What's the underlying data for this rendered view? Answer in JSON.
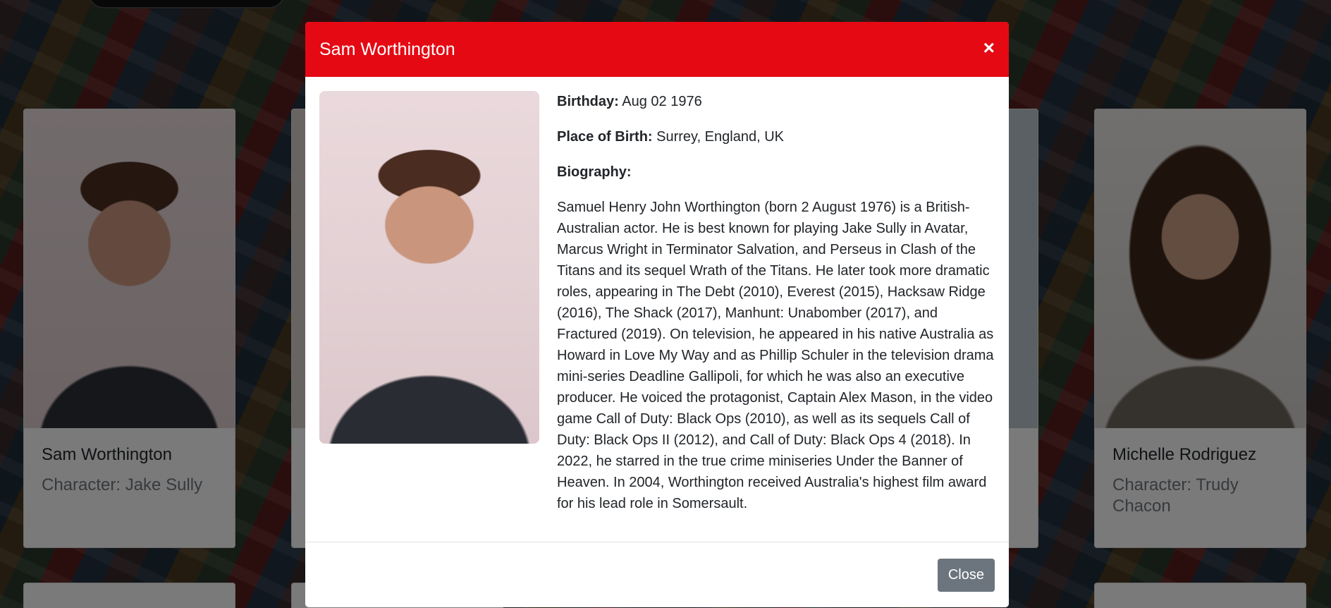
{
  "modal": {
    "title": "Sam Worthington",
    "close_icon": "×",
    "birthday_label": "Birthday:",
    "birthday_value": "Aug 02 1976",
    "place_label": "Place of Birth:",
    "place_value": "Surrey, England, UK",
    "bio_label": "Biography:",
    "bio_text": "Samuel Henry John Worthington (born 2 August 1976) is a British-Australian actor. He is best known for playing Jake Sully in Avatar, Marcus Wright in Terminator Salvation, and Perseus in Clash of the Titans and its sequel Wrath of the Titans. He later took more dramatic roles, appearing in The Debt (2010), Everest (2015), Hacksaw Ridge (2016), The Shack (2017), Manhunt: Unabomber (2017), and Fractured (2019). On television, he appeared in his native Australia as Howard in Love My Way and as Phillip Schuler in the television drama mini-series Deadline Gallipoli, for which he was also an executive producer. He voiced the protagonist, Captain Alex Mason, in the video game Call of Duty: Black Ops (2010), as well as its sequels Call of Duty: Black Ops II (2012), and Call of Duty: Black Ops 4 (2018). In 2022, he starred in the true crime miniseries Under the Banner of Heaven. In 2004, Worthington received Australia's highest film award for his lead role in Somersault.",
    "close_button": "Close"
  },
  "cast": [
    {
      "name": "Sam Worthington",
      "character": "Character: Jake Sully"
    },
    {
      "name": "Michelle Rodriguez",
      "character": "Character: Trudy Chacon"
    }
  ],
  "colors": {
    "header_red": "#e50914",
    "close_button_gray": "#6c757d"
  }
}
